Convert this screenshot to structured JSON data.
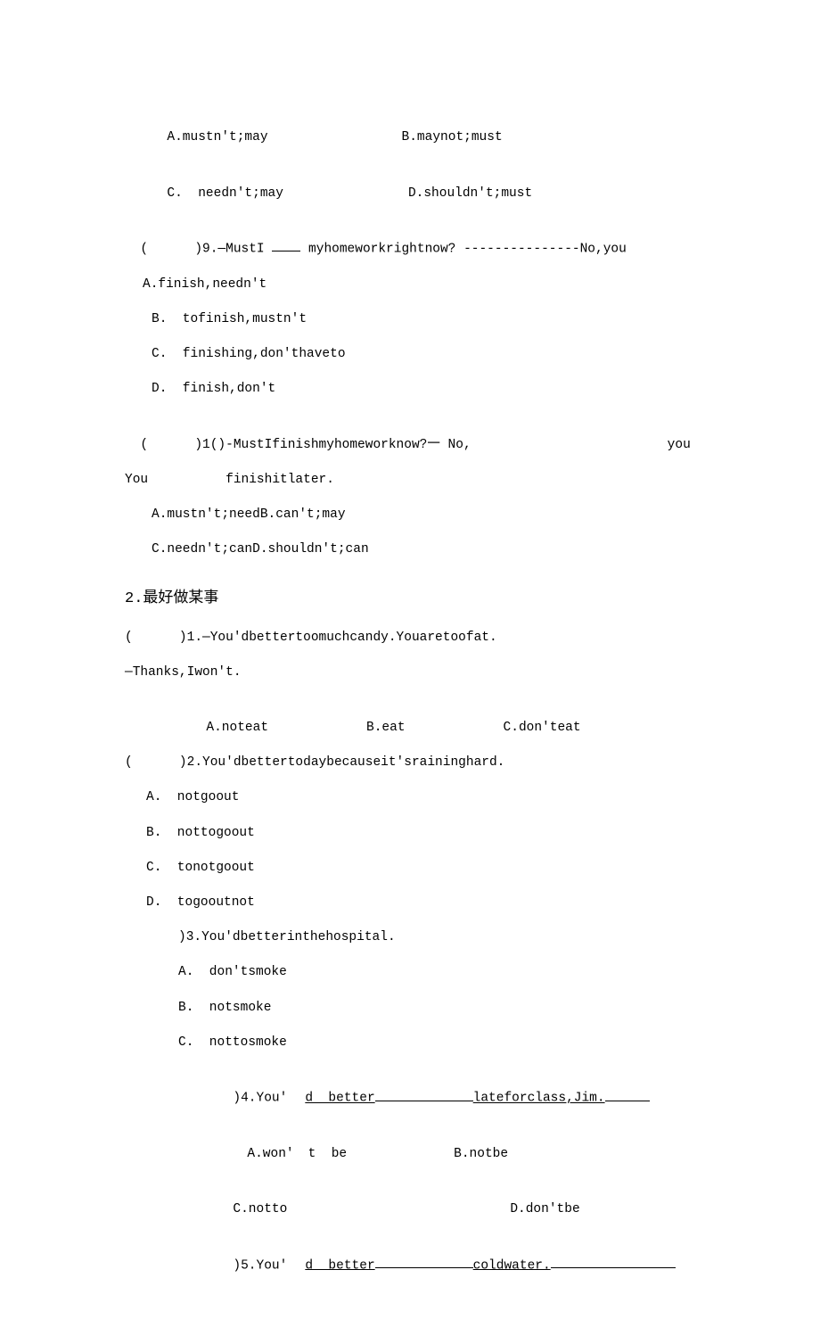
{
  "q8": {
    "a": "A.mustn't;may",
    "b": "B.maynot;must",
    "c": "C.  needn't;may",
    "d": "D.shouldn't;must"
  },
  "q9": {
    "stem_pre": "(      )9.—MustI ",
    "stem_post": "myhomeworkrightnow? ---------------No,you",
    "a": "A.finish,needn't",
    "b": "B.  tofinish,mustn't",
    "c": "C.  finishing,don'thaveto",
    "d": "D.  finish,don't"
  },
  "q10": {
    "line1_pre": "(      )1()-MustIfinishmyhomeworknow?一 No,",
    "line1_post": "you",
    "line2": "You          finishitlater.",
    "ab": "A.mustn't;needB.can't;may",
    "cd": "C.needn't;canD.shouldn't;can"
  },
  "section2_title": "2.最好做某事",
  "s2q1": {
    "stem": "(      )1.—You'dbettertoomuchcandy.Youaretoofat.",
    "line2": "—Thanks,Iwon't.",
    "a": "A.noteat",
    "b": "B.eat",
    "c": "C.don'teat"
  },
  "s2q2": {
    "stem": "(      )2.You'dbettertodaybecauseit'sraininghard.",
    "a": "A.  notgoout",
    "b": "B.  nottogoout",
    "c": "C.  tonotgoout",
    "d": "D.  togooutnot"
  },
  "s2q3": {
    "stem": ")3.You'dbetterinthehospital.",
    "a": "A.  don'tsmoke",
    "b": "B.  notsmoke",
    "c": "C.  nottosmoke"
  },
  "s2q4": {
    "stem_pre": ")4.You'",
    "stem_mid": "d  better",
    "stem_post": "lateforclass,Jim.",
    "a_pre": "A.won'",
    "a_post": "t  be",
    "b": "B.notbe",
    "c": "C.notto",
    "d": "D.don'tbe"
  },
  "s2q5": {
    "stem_pre": ")5.You'",
    "stem_mid": "d  better",
    "stem_post": "coldwater."
  }
}
